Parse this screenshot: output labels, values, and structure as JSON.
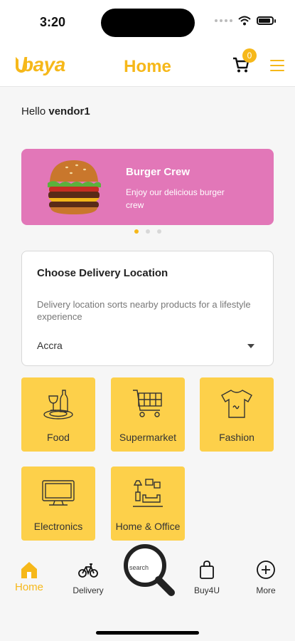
{
  "status_bar": {
    "time": "3:20"
  },
  "header": {
    "logo_text": "baya",
    "title": "Home",
    "cart_count": "0"
  },
  "greeting": {
    "prefix": "Hello",
    "username": "vendor1"
  },
  "banner": {
    "title": "Burger Crew",
    "subtitle": "Enjoy our delicious burger crew",
    "bg_color": "#e277b8",
    "slide_count": 3,
    "active_slide": 0
  },
  "delivery": {
    "title": "Choose Delivery Location",
    "description": "Delivery location sorts nearby products for a lifestyle experience",
    "selected_location": "Accra"
  },
  "categories": [
    {
      "label": "Food",
      "icon": "food-plate-icon"
    },
    {
      "label": "Supermarket",
      "icon": "shopping-cart-icon"
    },
    {
      "label": "Fashion",
      "icon": "tshirt-icon"
    },
    {
      "label": "Electronics",
      "icon": "tv-icon"
    },
    {
      "label": "Home & Office",
      "icon": "furniture-icon"
    }
  ],
  "bottom_nav": {
    "items": [
      {
        "label": "Home",
        "icon": "home-icon",
        "active": true
      },
      {
        "label": "Delivery",
        "icon": "bicycle-icon",
        "active": false
      },
      {
        "label": "search",
        "icon": "search-icon",
        "active": false
      },
      {
        "label": "Buy4U",
        "icon": "shopping-bag-icon",
        "active": false
      },
      {
        "label": "More",
        "icon": "plus-circle-icon",
        "active": false
      }
    ]
  },
  "colors": {
    "accent": "#f6b81a",
    "category_bg": "#fdd04a",
    "banner_bg": "#e277b8"
  }
}
